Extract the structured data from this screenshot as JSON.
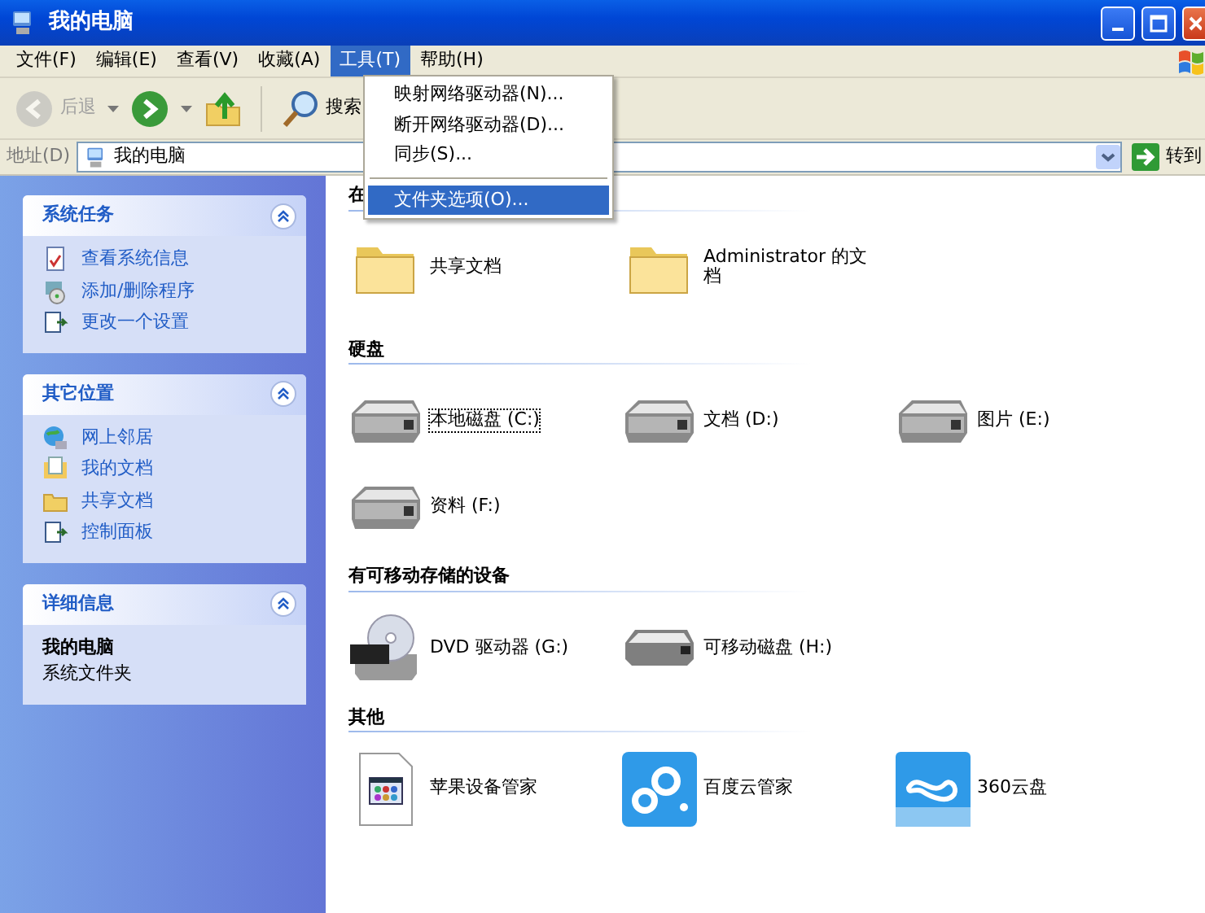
{
  "window": {
    "title": "我的电脑"
  },
  "menu_bar": [
    {
      "label": "文件(F)",
      "selected": false
    },
    {
      "label": "编辑(E)",
      "selected": false
    },
    {
      "label": "查看(V)",
      "selected": false
    },
    {
      "label": "收藏(A)",
      "selected": false
    },
    {
      "label": "工具(T)",
      "selected": true
    },
    {
      "label": "帮助(H)",
      "selected": false
    }
  ],
  "tools_menu": [
    {
      "kind": "item",
      "label": "映射网络驱动器(N)...",
      "selected": false
    },
    {
      "kind": "item",
      "label": "断开网络驱动器(D)...",
      "selected": false
    },
    {
      "kind": "item",
      "label": "同步(S)...",
      "selected": false
    },
    {
      "kind": "separator"
    },
    {
      "kind": "item",
      "label": "文件夹选项(O)...",
      "selected": true
    }
  ],
  "toolbar": [
    {
      "kind": "back",
      "label": "后退",
      "disabled": true
    },
    {
      "kind": "forward",
      "disabled": false
    },
    {
      "kind": "up",
      "disabled": false
    },
    {
      "kind": "search",
      "label": "搜索",
      "disabled": false
    }
  ],
  "address_bar": {
    "label": "地址(D)",
    "value": "我的电脑",
    "go": "转到"
  },
  "sidebar": [
    {
      "title": "系统任务",
      "items": [
        {
          "kind": "info",
          "label": "查看系统信息"
        },
        {
          "kind": "programs",
          "label": "添加/删除程序"
        },
        {
          "kind": "settings",
          "label": "更改一个设置"
        }
      ]
    },
    {
      "title": "其它位置",
      "items": [
        {
          "kind": "network",
          "label": "网上邻居"
        },
        {
          "kind": "documents",
          "label": "我的文档"
        },
        {
          "kind": "folder",
          "label": "共享文档"
        },
        {
          "kind": "settings",
          "label": "控制面板"
        }
      ]
    },
    {
      "title": "详细信息",
      "details": {
        "name": "我的电脑",
        "type": "系统文件夹"
      }
    }
  ],
  "groups": [
    {
      "title": "在",
      "items": [
        {
          "kind": "folder",
          "label": "共享文档",
          "focused": false
        },
        {
          "kind": "folder",
          "label": "Administrator 的文档",
          "focused": false
        }
      ]
    },
    {
      "title": "硬盘",
      "items": [
        {
          "kind": "drive",
          "label": "本地磁盘 (C:)",
          "focused": true
        },
        {
          "kind": "drive",
          "label": "文档 (D:)",
          "focused": false
        },
        {
          "kind": "drive",
          "label": "图片 (E:)",
          "focused": false
        },
        {
          "kind": "drive",
          "label": "资料 (F:)",
          "focused": false
        }
      ]
    },
    {
      "title": "有可移动存储的设备",
      "items": [
        {
          "kind": "dvd",
          "label": "DVD 驱动器 (G:)",
          "focused": false
        },
        {
          "kind": "removable",
          "label": "可移动磁盘 (H:)",
          "focused": false
        }
      ]
    },
    {
      "title": "其他",
      "items": [
        {
          "kind": "appfile",
          "label": "苹果设备管家",
          "focused": false
        },
        {
          "kind": "baidu",
          "label": "百度云管家",
          "focused": false
        },
        {
          "kind": "cloud360",
          "label": "360云盘",
          "focused": false
        }
      ]
    }
  ]
}
